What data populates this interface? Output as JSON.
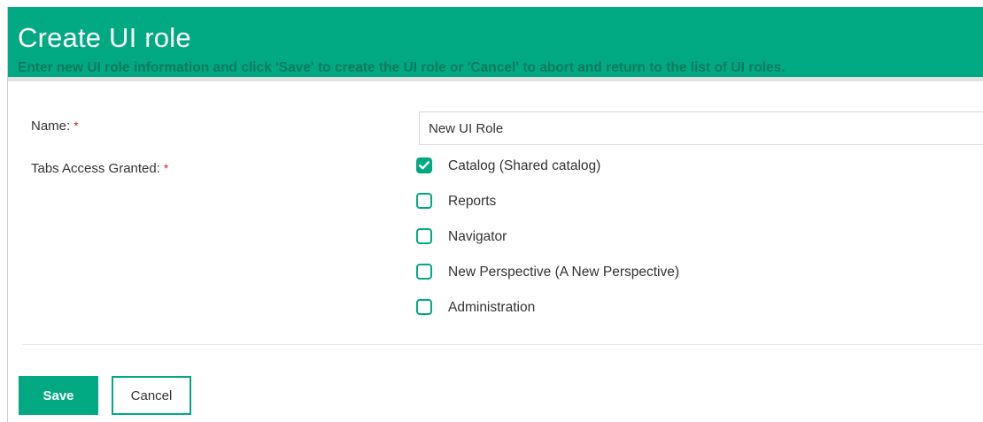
{
  "header": {
    "title": "Create UI role",
    "subtitle": "Enter new UI role information and click 'Save' to create the UI role or 'Cancel' to abort and return to the list of UI roles."
  },
  "form": {
    "name": {
      "label": "Name:",
      "required_mark": "*",
      "value": "New UI Role"
    },
    "tabs_access": {
      "label": "Tabs Access Granted:",
      "required_mark": "*",
      "options": [
        {
          "label": "Catalog (Shared catalog)",
          "checked": true
        },
        {
          "label": "Reports",
          "checked": false
        },
        {
          "label": "Navigator",
          "checked": false
        },
        {
          "label": "New Perspective (A New Perspective)",
          "checked": false
        },
        {
          "label": "Administration",
          "checked": false
        }
      ]
    }
  },
  "actions": {
    "save_label": "Save",
    "cancel_label": "Cancel"
  },
  "colors": {
    "brand": "#01a982",
    "subtitle_text": "#0e7a5f",
    "required": "#d8233b"
  }
}
